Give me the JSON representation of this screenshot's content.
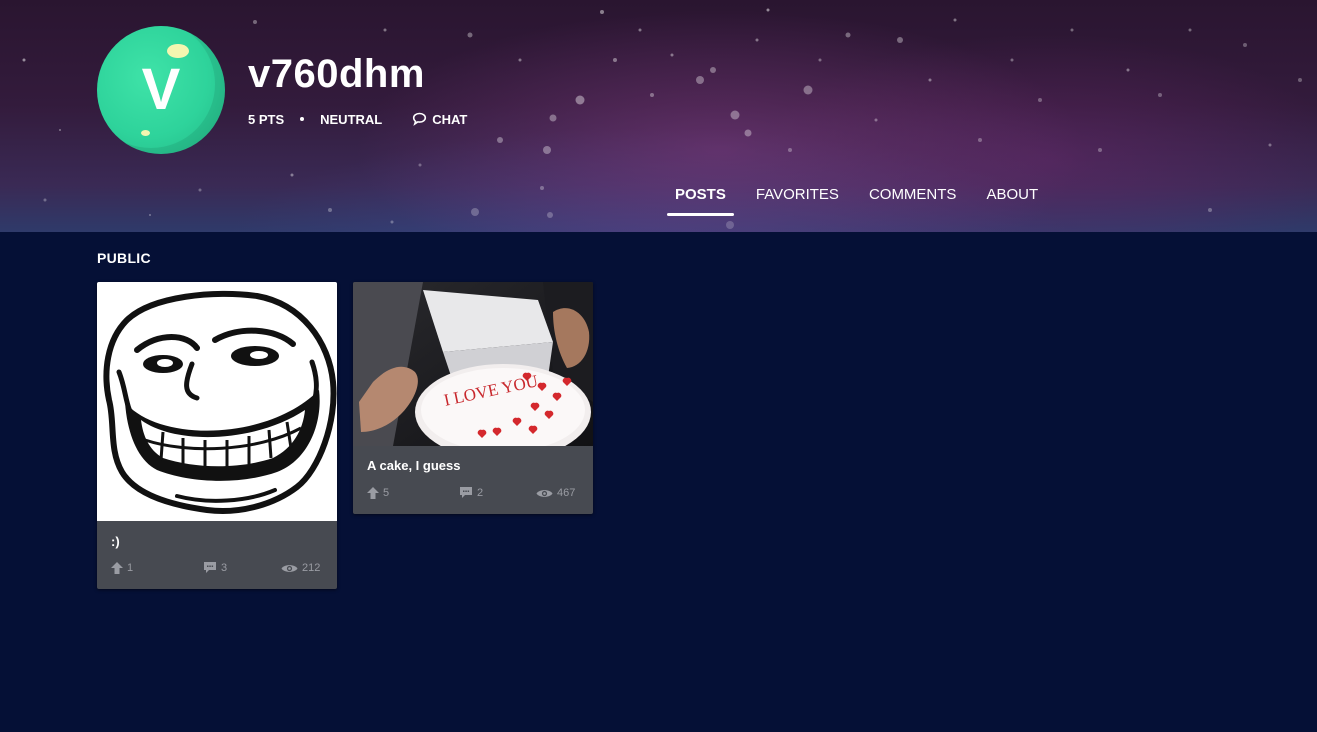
{
  "profile": {
    "avatar_letter": "V",
    "username": "v760dhm",
    "points": "5 PTS",
    "status": "NEUTRAL",
    "chat_label": "CHAT"
  },
  "tabs": [
    {
      "label": "POSTS",
      "active": true
    },
    {
      "label": "FAVORITES",
      "active": false
    },
    {
      "label": "COMMENTS",
      "active": false
    },
    {
      "label": "ABOUT",
      "active": false
    }
  ],
  "section": {
    "title": "PUBLIC"
  },
  "posts": [
    {
      "title": ":)",
      "upvotes": "1",
      "comments": "3",
      "views": "212",
      "image": "troll-face-image"
    },
    {
      "title": "A cake, I guess",
      "upvotes": "5",
      "comments": "2",
      "views": "467",
      "image": "cake-image",
      "image_text": "I LOVE YOU"
    }
  ],
  "colors": {
    "page_background": "#051036",
    "card_background": "#474a51",
    "avatar_green": "#2ed39b",
    "stat_gray": "#9a9ca3"
  },
  "icons": [
    "chat-bubble-icon",
    "upvote-arrow-icon",
    "comment-icon",
    "eye-icon"
  ]
}
